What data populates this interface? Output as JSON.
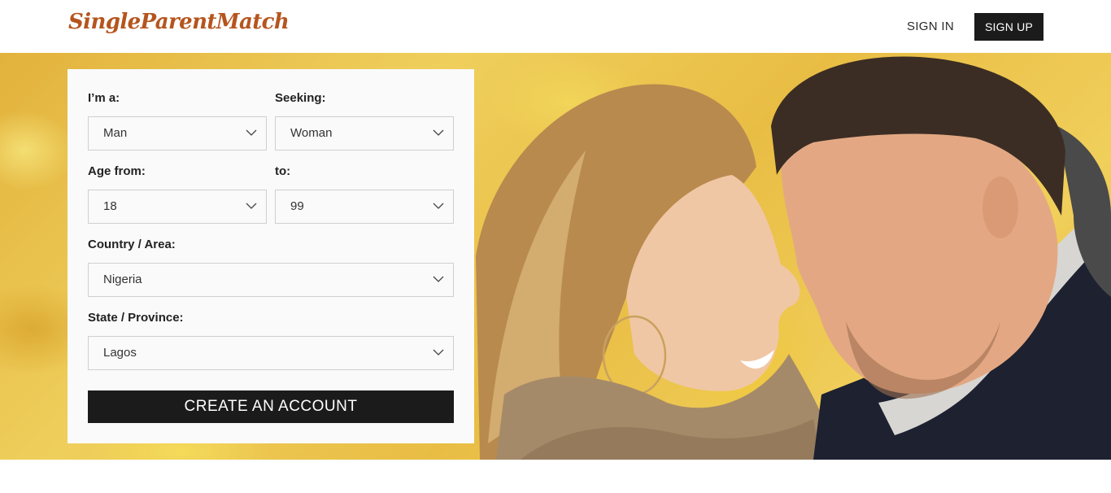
{
  "header": {
    "logo": "SingleParentMatch",
    "sign_in": "SIGN IN",
    "sign_up": "SIGN UP"
  },
  "hero": {
    "image_description": "smiling couple touching noses in autumn setting"
  },
  "form": {
    "im_a": {
      "label": "I’m a:",
      "value": "Man"
    },
    "seeking": {
      "label": "Seeking:",
      "value": "Woman"
    },
    "age_from": {
      "label": "Age from:",
      "value": "18"
    },
    "age_to": {
      "label": "to:",
      "value": "99"
    },
    "country": {
      "label": "Country / Area:",
      "value": "Nigeria"
    },
    "state": {
      "label": "State / Province:",
      "value": "Lagos"
    },
    "submit": "CREATE AN ACCOUNT"
  },
  "colors": {
    "brand": "#b5551e",
    "button_dark": "#1b1b1b",
    "panel_bg": "#fafafa",
    "hero_yellow": "#e9bd44"
  }
}
